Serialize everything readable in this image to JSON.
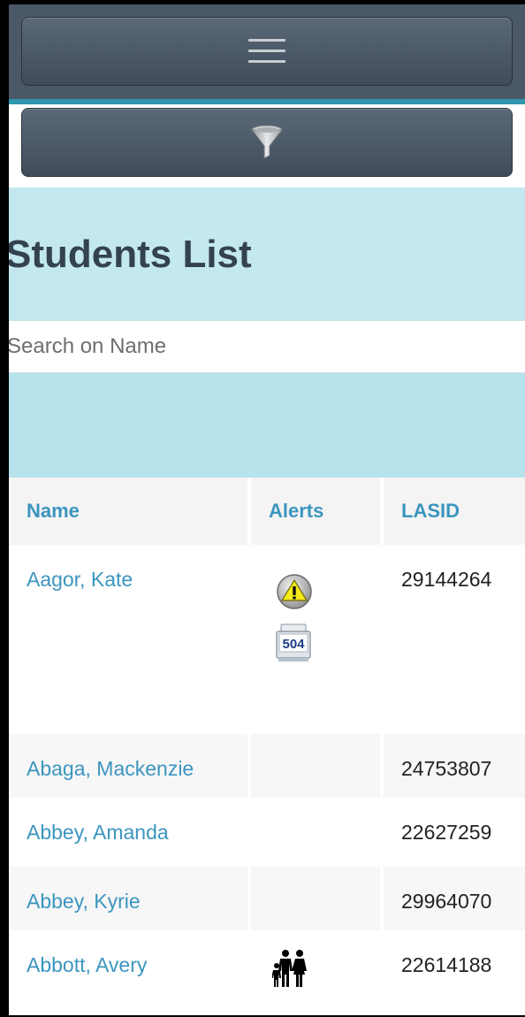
{
  "toolbar": {
    "menu_icon": "hamburger-menu-icon",
    "filter_icon": "funnel-filter-icon"
  },
  "page": {
    "title": "Students List",
    "search_placeholder": "Search on Name"
  },
  "table": {
    "headers": [
      "Name",
      "Alerts",
      "LASID"
    ],
    "rows": [
      {
        "name": "Aagor, Kate",
        "lasid": "29144264",
        "alerts": [
          "warning-icon",
          "504-plan-icon"
        ],
        "alert_504_label": "504"
      },
      {
        "name": "Abaga, Mackenzie",
        "lasid": "24753807",
        "alerts": []
      },
      {
        "name": "Abbey, Amanda",
        "lasid": "22627259",
        "alerts": []
      },
      {
        "name": "Abbey, Kyrie",
        "lasid": "29964070",
        "alerts": []
      },
      {
        "name": "Abbott, Avery",
        "lasid": "22614188",
        "alerts": [
          "family-icon"
        ]
      }
    ]
  },
  "colors": {
    "toolbar_bg": "#4a5868",
    "accent_teal": "#2f97ad",
    "header_band": "#c3e8ef",
    "link": "#3b95bf",
    "title": "#34424f"
  }
}
